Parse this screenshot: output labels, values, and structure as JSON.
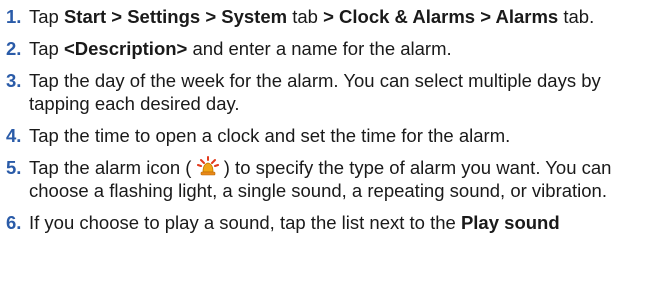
{
  "steps": [
    {
      "num": "1.",
      "parts": [
        {
          "text": "Tap ",
          "bold": false
        },
        {
          "text": "Start > Settings > System",
          "bold": true
        },
        {
          "text": " tab ",
          "bold": false
        },
        {
          "text": "> Clock & Alarms > Alarms",
          "bold": true
        },
        {
          "text": " tab.",
          "bold": false
        }
      ]
    },
    {
      "num": "2.",
      "parts": [
        {
          "text": "Tap ",
          "bold": false
        },
        {
          "text": "<Description>",
          "bold": true
        },
        {
          "text": " and enter a name for the alarm.",
          "bold": false
        }
      ]
    },
    {
      "num": "3.",
      "parts": [
        {
          "text": "Tap the day of the week for the alarm. You can select multiple days by tapping each desired day.",
          "bold": false
        }
      ]
    },
    {
      "num": "4.",
      "parts": [
        {
          "text": "Tap the time to open a clock and set the time for the alarm.",
          "bold": false
        }
      ]
    },
    {
      "num": "5.",
      "before_icon": "Tap the alarm icon ( ",
      "icon": "alarm-icon",
      "after_icon": " ) to specify the type of alarm you want. You can choose a flashing light, a single sound, a repeating sound, or vibration."
    },
    {
      "num": "6.",
      "parts": [
        {
          "text": "If you choose to play a sound, tap the list next to the ",
          "bold": false
        },
        {
          "text": "Play sound",
          "bold": true
        }
      ]
    }
  ],
  "colors": {
    "number": "#2a5ba8",
    "text": "#1a1a1a",
    "icon_bell": "#f2a516",
    "icon_rays": "#e23a1c"
  }
}
